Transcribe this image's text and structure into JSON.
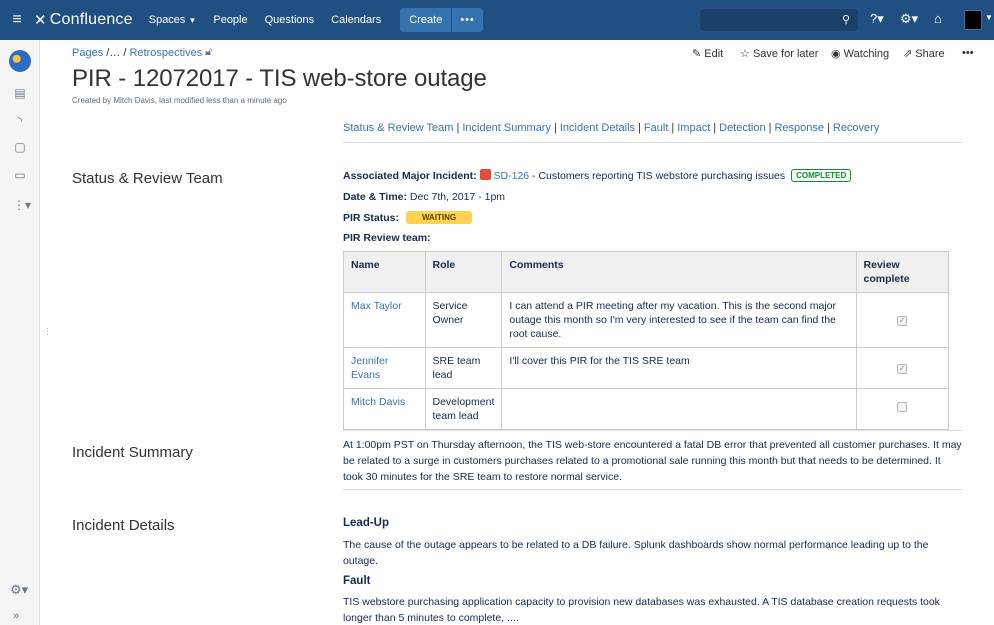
{
  "nav": {
    "logo": "Confluence",
    "spaces": "Spaces",
    "people": "People",
    "questions": "Questions",
    "calendars": "Calendars",
    "create": "Create",
    "more": "•••"
  },
  "breadcrumb": {
    "root": "Pages",
    "sep": " /… / ",
    "parent": "Retrospectives"
  },
  "actions": {
    "edit": "Edit",
    "save": "Save for later",
    "watching": "Watching",
    "share": "Share",
    "more": "•••"
  },
  "page": {
    "title": "PIR - 12072017 - TIS web-store outage",
    "byline": "Created by Mitch Davis, last modified less than a minute ago"
  },
  "toc": [
    "Status & Review Team",
    "Incident Summary",
    "Incident Details",
    "Fault",
    "Impact",
    "Detection",
    "Response",
    "Recovery"
  ],
  "status_section": {
    "label": "Status & Review Team",
    "incident_label": "Associated Major Incident:",
    "incident_key": "SD-126",
    "incident_summary": " - Customers reporting TIS webstore purchasing issues",
    "incident_status": "COMPLETED",
    "datetime_label": "Date & Time:",
    "datetime_value": " Dec 7th, 2017 - 1pm",
    "pir_status_label": "PIR Status:",
    "pir_status_value": "WAITING",
    "team_label": "PIR Review team:"
  },
  "review_table": {
    "headers": [
      "Name",
      "Role",
      "Comments",
      "Review complete"
    ],
    "rows": [
      {
        "name": "Max Taylor",
        "role": "Service Owner",
        "comments": "I can attend a PIR meeting after my vacation. This is the second major outage this month so I'm very interested to see if the team can find the root cause.",
        "complete": true
      },
      {
        "name": "Jennifer Evans",
        "role": "SRE team lead",
        "comments": "I'll cover this PIR for the TIS SRE team",
        "complete": true
      },
      {
        "name": "Mitch Davis",
        "role": "Development team lead",
        "comments": "",
        "complete": false
      }
    ]
  },
  "summary_section": {
    "label": "Incident Summary",
    "text": "At 1:00pm PST on Thursday afternoon, the TIS web-store encountered a fatal DB error that prevented all customer purchases.  It may be related to a surge in customers purchases related to a promotional sale running this month but that needs to be determined.  It took 30 minutes for the SRE team to restore normal service."
  },
  "details_section": {
    "label": "Incident Details",
    "leadup_title": "Lead-Up",
    "leadup_text": "The cause of the outage appears to be related to a DB failure. Splunk dashboards show normal performance leading up to the outage.",
    "fault_title": "Fault",
    "fault_text": "TIS webstore purchasing application capacity to provision new databases was exhausted. A TIS database creation requests took longer than 5 minutes to complete, ...."
  }
}
